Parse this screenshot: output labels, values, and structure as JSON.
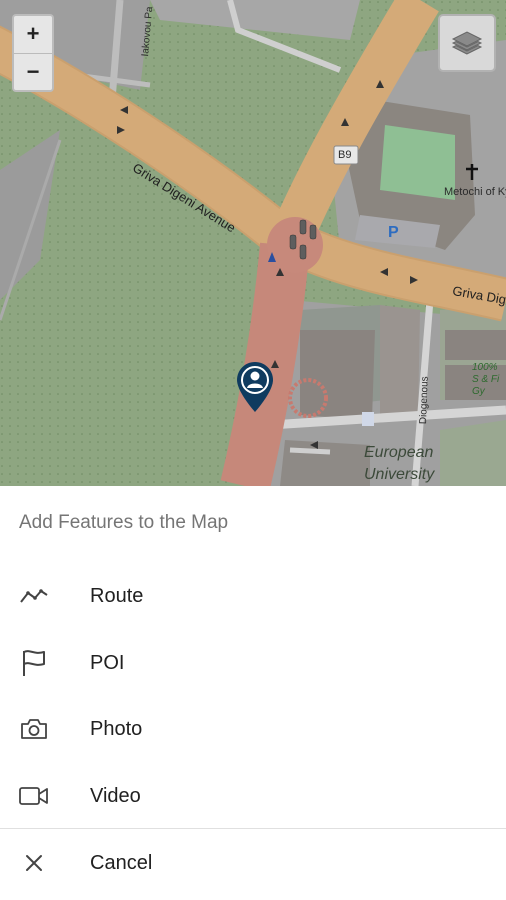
{
  "map": {
    "street_griva_left": "Griva Digeni Avenue",
    "street_griva_right": "Griva Dig",
    "street_iakovou": "Iakovou Pa",
    "street_diogenous": "Diogenous",
    "road_ref": "B9",
    "poi_metochi": "Metochi of Kykkos",
    "poi_university": "European University",
    "green_label": "100% S & Fi Gy",
    "parking": "P",
    "zoom_in": "+",
    "zoom_out": "−"
  },
  "sheet": {
    "title": "Add Features to the Map",
    "items": [
      {
        "label": "Route",
        "icon": "route-icon"
      },
      {
        "label": "POI",
        "icon": "flag-icon"
      },
      {
        "label": "Photo",
        "icon": "camera-icon"
      },
      {
        "label": "Video",
        "icon": "video-icon"
      }
    ],
    "cancel": {
      "label": "Cancel",
      "icon": "close-icon"
    }
  },
  "colors": {
    "map_green": "#8ea681",
    "map_grey": "#9a9a9a",
    "primary_road": "#d0a777",
    "pedestrian": "#c68a7a",
    "marker": "#0f3b5f"
  }
}
